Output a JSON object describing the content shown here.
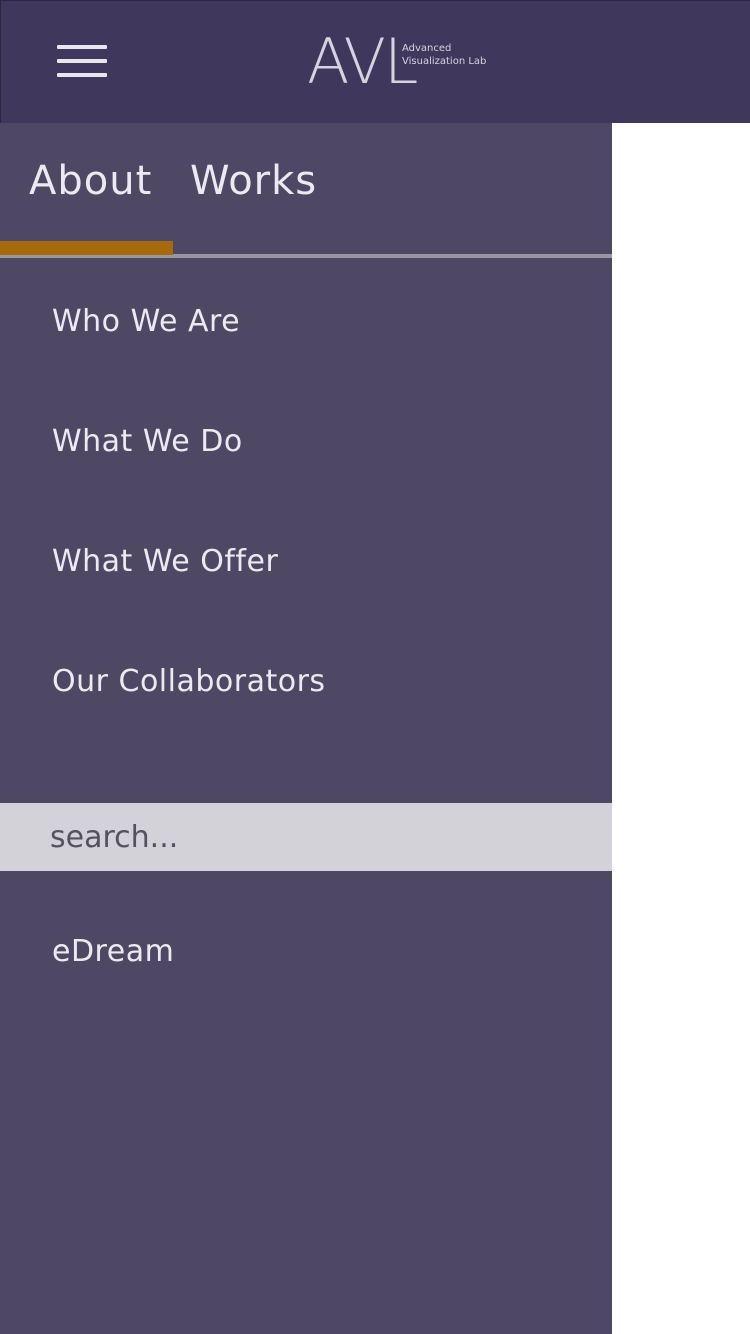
{
  "header": {
    "menu_icon": "hamburger-menu-icon",
    "logo": {
      "mark": "AVL",
      "line1": "Advanced",
      "line2": "Visualization Lab"
    },
    "background_color": "#40385c"
  },
  "drawer": {
    "background_color": "#4e4865",
    "tabs": [
      {
        "label": "About",
        "active": true
      },
      {
        "label": "Works",
        "active": false
      }
    ],
    "active_tab_color": "#a7690d",
    "menu_items": [
      {
        "label": "Who We Are"
      },
      {
        "label": "What We Do"
      },
      {
        "label": "What We Offer"
      },
      {
        "label": "Our Collaborators"
      }
    ],
    "search": {
      "placeholder": "search...",
      "value": ""
    },
    "footer_item": {
      "label": "eDream"
    }
  }
}
